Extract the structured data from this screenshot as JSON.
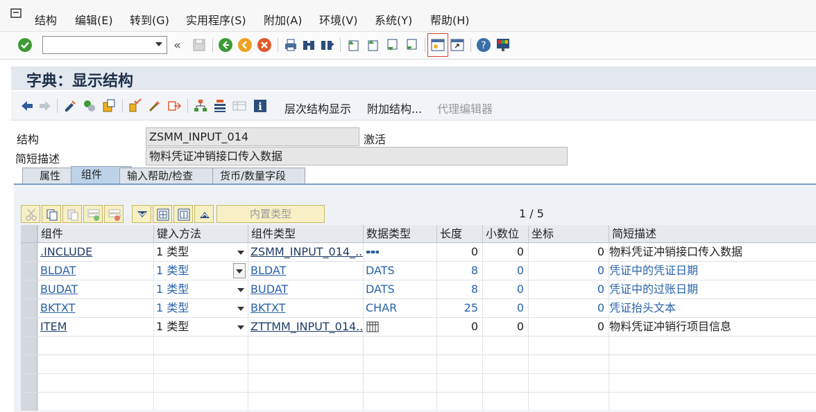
{
  "menu": [
    "结构",
    "编辑(E)",
    "转到(G)",
    "实用程序(S)",
    "附加(A)",
    "环境(V)",
    "系统(Y)",
    "帮助(H)"
  ],
  "title": "字典：显示结构",
  "appbar": {
    "hierarchy": "层次结构显示",
    "append": "附加结构...",
    "proxy_editor": "代理编辑器"
  },
  "fields": {
    "structure_label": "结构",
    "structure_value": "ZSMM_INPUT_014",
    "status": "激活",
    "desc_label": "简短描述",
    "desc_value": "物料凭证冲销接口传入数据"
  },
  "tabs": [
    "属性",
    "组件",
    "输入帮助/检查",
    "货币/数量字段"
  ],
  "grid_tools": {
    "builtin_type": "内置类型"
  },
  "pager": "1 / 5",
  "columns": [
    "组件",
    "键入方法",
    "组件类型",
    "数据类型",
    "长度",
    "小数位",
    "坐标",
    "简短描述"
  ],
  "rows": [
    {
      "component": ".INCLUDE",
      "typing": "1 类型",
      "comp_type": "ZSMM_INPUT_014_...",
      "data_type": "",
      "data_type_icon": "structure-icon",
      "length": "0",
      "decimals": "0",
      "coord": "0",
      "desc": "物料凭证冲销接口传入数据",
      "style": "normal"
    },
    {
      "component": "BLDAT",
      "typing": "1 类型",
      "comp_type": "BLDAT",
      "data_type": "DATS",
      "length": "8",
      "decimals": "0",
      "coord": "0",
      "desc": "凭证中的凭证日期",
      "style": "blue"
    },
    {
      "component": "BUDAT",
      "typing": "1 类型",
      "comp_type": "BUDAT",
      "data_type": "DATS",
      "length": "8",
      "decimals": "0",
      "coord": "0",
      "desc": "凭证中的过账日期",
      "style": "blue"
    },
    {
      "component": "BKTXT",
      "typing": "1 类型",
      "comp_type": "BKTXT",
      "data_type": "CHAR",
      "length": "25",
      "decimals": "0",
      "coord": "0",
      "desc": "凭证抬头文本",
      "style": "blue"
    },
    {
      "component": "ITEM",
      "typing": "1 类型",
      "comp_type": "ZTTMM_INPUT_014...",
      "data_type": "",
      "data_type_icon": "table-icon",
      "length": "0",
      "decimals": "0",
      "coord": "0",
      "desc": "物料凭证冲销行项目信息",
      "style": "normal"
    }
  ]
}
